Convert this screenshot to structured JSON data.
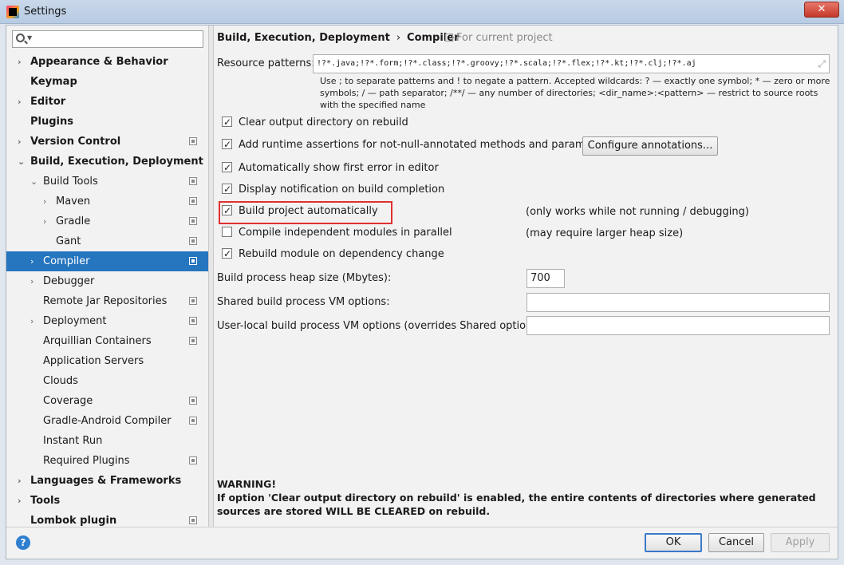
{
  "window": {
    "title": "Settings"
  },
  "sidebar": {
    "search_placeholder": "",
    "items": [
      {
        "label": "Appearance & Behavior",
        "bold": true,
        "level": 0,
        "arrow": "right",
        "icon": false
      },
      {
        "label": "Keymap",
        "bold": true,
        "level": 0,
        "arrow": "none",
        "icon": false
      },
      {
        "label": "Editor",
        "bold": true,
        "level": 0,
        "arrow": "right",
        "icon": false
      },
      {
        "label": "Plugins",
        "bold": true,
        "level": 0,
        "arrow": "none",
        "icon": false
      },
      {
        "label": "Version Control",
        "bold": true,
        "level": 0,
        "arrow": "right",
        "icon": true
      },
      {
        "label": "Build, Execution, Deployment",
        "bold": true,
        "level": 0,
        "arrow": "down",
        "icon": false
      },
      {
        "label": "Build Tools",
        "bold": false,
        "level": 1,
        "arrow": "down",
        "icon": true
      },
      {
        "label": "Maven",
        "bold": false,
        "level": 2,
        "arrow": "right",
        "icon": true
      },
      {
        "label": "Gradle",
        "bold": false,
        "level": 2,
        "arrow": "right",
        "icon": true
      },
      {
        "label": "Gant",
        "bold": false,
        "level": 2,
        "arrow": "none",
        "icon": true
      },
      {
        "label": "Compiler",
        "bold": false,
        "level": 1,
        "arrow": "right",
        "icon": true,
        "selected": true
      },
      {
        "label": "Debugger",
        "bold": false,
        "level": 1,
        "arrow": "right",
        "icon": false
      },
      {
        "label": "Remote Jar Repositories",
        "bold": false,
        "level": 1,
        "arrow": "none",
        "icon": true
      },
      {
        "label": "Deployment",
        "bold": false,
        "level": 1,
        "arrow": "right",
        "icon": true
      },
      {
        "label": "Arquillian Containers",
        "bold": false,
        "level": 1,
        "arrow": "none",
        "icon": true
      },
      {
        "label": "Application Servers",
        "bold": false,
        "level": 1,
        "arrow": "none",
        "icon": false
      },
      {
        "label": "Clouds",
        "bold": false,
        "level": 1,
        "arrow": "none",
        "icon": false
      },
      {
        "label": "Coverage",
        "bold": false,
        "level": 1,
        "arrow": "none",
        "icon": true
      },
      {
        "label": "Gradle-Android Compiler",
        "bold": false,
        "level": 1,
        "arrow": "none",
        "icon": true
      },
      {
        "label": "Instant Run",
        "bold": false,
        "level": 1,
        "arrow": "none",
        "icon": false
      },
      {
        "label": "Required Plugins",
        "bold": false,
        "level": 1,
        "arrow": "none",
        "icon": true
      },
      {
        "label": "Languages & Frameworks",
        "bold": true,
        "level": 0,
        "arrow": "right",
        "icon": false
      },
      {
        "label": "Tools",
        "bold": true,
        "level": 0,
        "arrow": "right",
        "icon": false
      },
      {
        "label": "Lombok plugin",
        "bold": true,
        "level": 0,
        "arrow": "none",
        "icon": true
      }
    ]
  },
  "header": {
    "crumb1": "Build, Execution, Deployment",
    "separator": "›",
    "crumb2": "Compiler",
    "scope": "For current project"
  },
  "resource": {
    "label": "Resource patterns:",
    "value": "!?*.java;!?*.form;!?*.class;!?*.groovy;!?*.scala;!?*.flex;!?*.kt;!?*.clj;!?*.aj",
    "hint": "Use ; to separate patterns and ! to negate a pattern. Accepted wildcards: ? — exactly one symbol; * — zero or more symbols; / — path separator; /**/ — any number of directories; <dir_name>:<pattern> — restrict to source roots with the specified name"
  },
  "options": [
    {
      "label": "Clear output directory on rebuild",
      "checked": true
    },
    {
      "label": "Add runtime assertions for not-null-annotated methods and parameters",
      "checked": true
    },
    {
      "label": "Automatically show first error in editor",
      "checked": true
    },
    {
      "label": "Display notification on build completion",
      "checked": true
    },
    {
      "label": "Build project automatically",
      "checked": true
    },
    {
      "label": "Compile independent modules in parallel",
      "checked": false
    },
    {
      "label": "Rebuild module on dependency change",
      "checked": true
    }
  ],
  "configure_button": "Configure annotations...",
  "notes": {
    "build_auto": "(only works while not running / debugging)",
    "parallel": "(may require larger heap size)"
  },
  "heap": {
    "label": "Build process heap size (Mbytes):",
    "value": "700"
  },
  "shared_vm": {
    "label": "Shared build process VM options:",
    "value": ""
  },
  "user_vm": {
    "label": "User-local build process VM options (overrides Shared options):",
    "value": ""
  },
  "warning": {
    "title": "WARNING!",
    "text": "If option 'Clear output directory on rebuild' is enabled, the entire contents of directories where generated sources are stored WILL BE CLEARED on rebuild."
  },
  "footer": {
    "help": "?",
    "ok": "OK",
    "cancel": "Cancel",
    "apply": "Apply"
  },
  "colors": {
    "selection": "#2675bf",
    "highlight_box": "#e03030"
  }
}
